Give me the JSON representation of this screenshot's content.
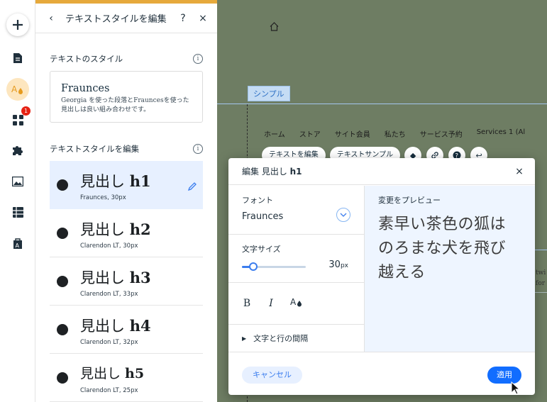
{
  "rail": {
    "badge": "1",
    "icons": [
      "add-icon",
      "pages-icon",
      "design-icon",
      "apps-icon",
      "plugins-icon",
      "media-icon",
      "cms-icon",
      "business-icon"
    ]
  },
  "panel": {
    "title": "テキストスタイルを編集",
    "help": "?",
    "close": "×",
    "section1_label": "テキストのスタイル",
    "card": {
      "font_name": "Fraunces",
      "description_line1": "Georgia を使った段落とFrauncesを使った",
      "description_line2": "見出しは良い組み合わせです。"
    },
    "section2_label": "テキストスタイルを編集",
    "items": [
      {
        "prefix": "見出し ",
        "tag": "h1",
        "font": "Fraunces, 30px"
      },
      {
        "prefix": "見出し ",
        "tag": "h2",
        "font": "Clarendon LT, 30px"
      },
      {
        "prefix": "見出し ",
        "tag": "h3",
        "font": "Clarendon LT, 33px"
      },
      {
        "prefix": "見出し ",
        "tag": "h4",
        "font": "Clarendon LT, 32px"
      },
      {
        "prefix": "見出し ",
        "tag": "h5",
        "font": "Clarendon LT, 25px"
      }
    ]
  },
  "canvas": {
    "tag_label": "シンプル",
    "nav": [
      "ホーム",
      "ストア",
      "サイト会員",
      "私たち",
      "サービス予約",
      "Services 1 (Al"
    ],
    "toolbar": {
      "edit_text": "テキストを編集",
      "text_sample": "テキストサンプル"
    },
    "right_fragment": [
      "twi",
      "for"
    ]
  },
  "dialog": {
    "title_prefix": "編集 見出し ",
    "title_tag": "h1",
    "close": "×",
    "font_label": "フォント",
    "font_value": "Fraunces",
    "size_label": "文字サイズ",
    "size_value": "30",
    "size_unit": "px",
    "size_fraction": 0.18,
    "bold": "B",
    "italic": "I",
    "spacing_label": "文字と行の間隔",
    "preview_label": "変更をプレビュー",
    "preview_line1": "素早い茶色の狐は",
    "preview_line2": "のろまな犬を飛び",
    "preview_line3": "越える",
    "cancel": "キャンセル",
    "apply": "適用"
  }
}
